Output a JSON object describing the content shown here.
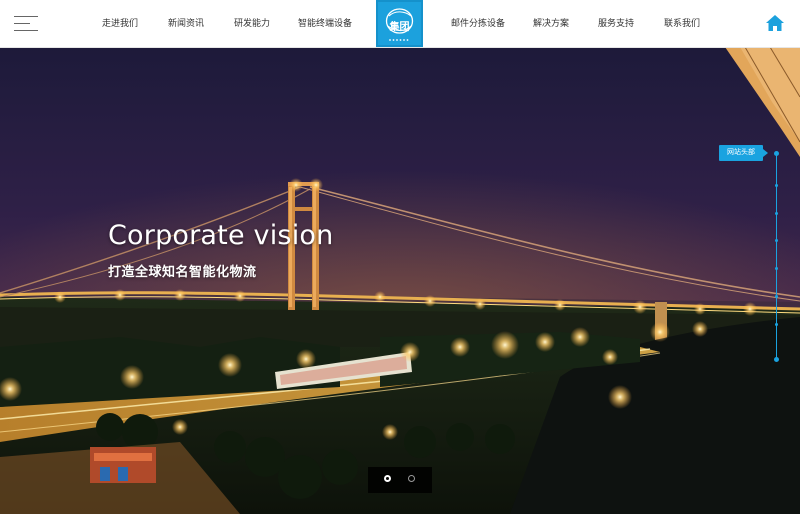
{
  "header": {
    "nav_left": [
      "走进我们",
      "新闻资讯",
      "研发能力",
      "智能终端设备"
    ],
    "logo_text": "集团",
    "nav_right": [
      "邮件分拣设备",
      "解决方案",
      "服务支持",
      "联系我们"
    ]
  },
  "hero": {
    "title": "Corporate vision",
    "subtitle": "打造全球知名智能化物流",
    "side_tag": "网站头部",
    "slide_count": 2,
    "active_slide": 1
  },
  "colors": {
    "accent": "#1ca1dd",
    "nav_text": "#333333"
  }
}
